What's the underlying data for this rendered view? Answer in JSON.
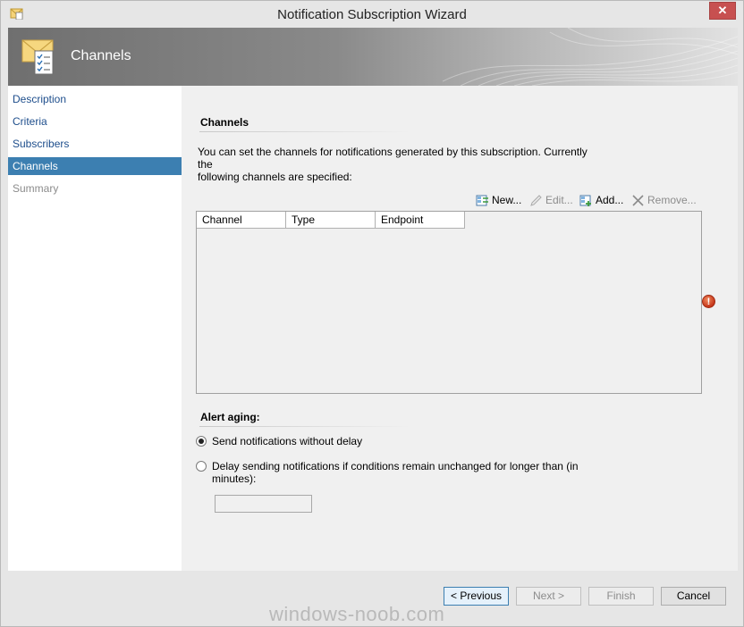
{
  "window": {
    "title": "Notification Subscription Wizard",
    "close_glyph": "✕"
  },
  "banner": {
    "title": "Channels"
  },
  "nav": {
    "items": [
      {
        "label": "Description",
        "state": "normal"
      },
      {
        "label": "Criteria",
        "state": "normal"
      },
      {
        "label": "Subscribers",
        "state": "normal"
      },
      {
        "label": "Channels",
        "state": "active"
      },
      {
        "label": "Summary",
        "state": "disabled"
      }
    ]
  },
  "channels": {
    "heading": "Channels",
    "description_line1": "You can set the channels for notifications generated by this subscription.  Currently the",
    "description_line2": "following channels are specified:",
    "toolbar": {
      "new_label": "New...",
      "edit_label": "Edit...",
      "add_label": "Add...",
      "remove_label": "Remove..."
    },
    "columns": [
      "Channel",
      "Type",
      "Endpoint"
    ],
    "rows": [],
    "error_glyph": "!"
  },
  "alert_aging": {
    "heading": "Alert aging:",
    "option_immediate": "Send notifications without delay",
    "option_delay_line1": "Delay sending notifications if conditions remain unchanged for longer than (in",
    "option_delay_line2": "minutes):",
    "selected": "immediate",
    "minutes_value": ""
  },
  "footer": {
    "previous_label": "< Previous",
    "next_label": "Next >",
    "finish_label": "Finish",
    "cancel_label": "Cancel"
  },
  "watermark": "windows-noob.com",
  "colors": {
    "nav_active": "#3c7fb1",
    "nav_link": "#1e4e8c",
    "error": "#c5361b",
    "close_button": "#c75050"
  },
  "icons": {
    "app": "wizard-app-icon",
    "banner": "envelope-checklist-icon",
    "new": "new-channel-icon",
    "edit": "pencil-icon",
    "add": "add-channel-icon",
    "remove": "x-icon",
    "error": "error-icon"
  }
}
